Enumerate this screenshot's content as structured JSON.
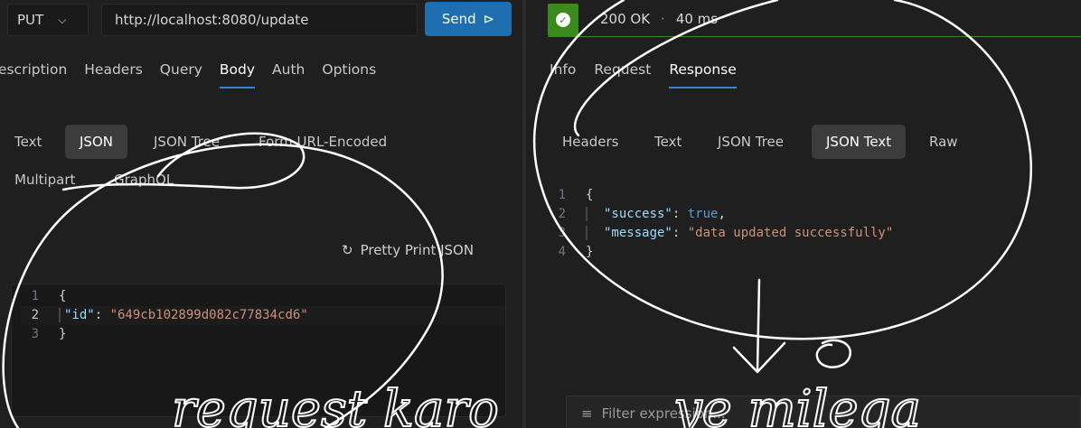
{
  "request": {
    "method": "PUT",
    "url": "http://localhost:8080/update",
    "send_label": "Send"
  },
  "request_tabs": [
    "Description",
    "Headers",
    "Query",
    "Body",
    "Auth",
    "Options"
  ],
  "request_active_tab": "Body",
  "body_types": [
    "Text",
    "JSON",
    "JSON Tree",
    "Form URL-Encoded",
    "Multipart",
    "GraphQL"
  ],
  "body_active_type": "JSON",
  "pretty_print_label": "Pretty Print JSON",
  "request_body": {
    "line_numbers": [
      "1",
      "2",
      "3"
    ],
    "open_brace": "{",
    "key": "\"id\"",
    "colon": ": ",
    "value": "\"649cb102899d082c77834cd6\"",
    "close_brace": "}"
  },
  "response": {
    "status": "200 OK",
    "separator": "·",
    "time": "40 ms",
    "tabs": [
      "Info",
      "Request",
      "Response"
    ],
    "active_tab": "Response",
    "view_types": [
      "Headers",
      "Text",
      "JSON Tree",
      "JSON Text",
      "Raw"
    ],
    "active_view": "JSON Text",
    "body": {
      "line_numbers": [
        "1",
        "2",
        "3",
        "4"
      ],
      "open_brace": "{",
      "key1": "\"success\"",
      "val1": "true",
      "key2": "\"message\"",
      "val2": "\"data updated successfully\"",
      "close_brace": "}"
    },
    "filter_placeholder": "Filter expression..."
  },
  "annotations": {
    "left_text": "request karo",
    "right_text": "ye milega"
  },
  "colors": {
    "accent": "#3b82d6",
    "send_button": "#1f6fb0",
    "status_ok": "#3a8a1e"
  }
}
